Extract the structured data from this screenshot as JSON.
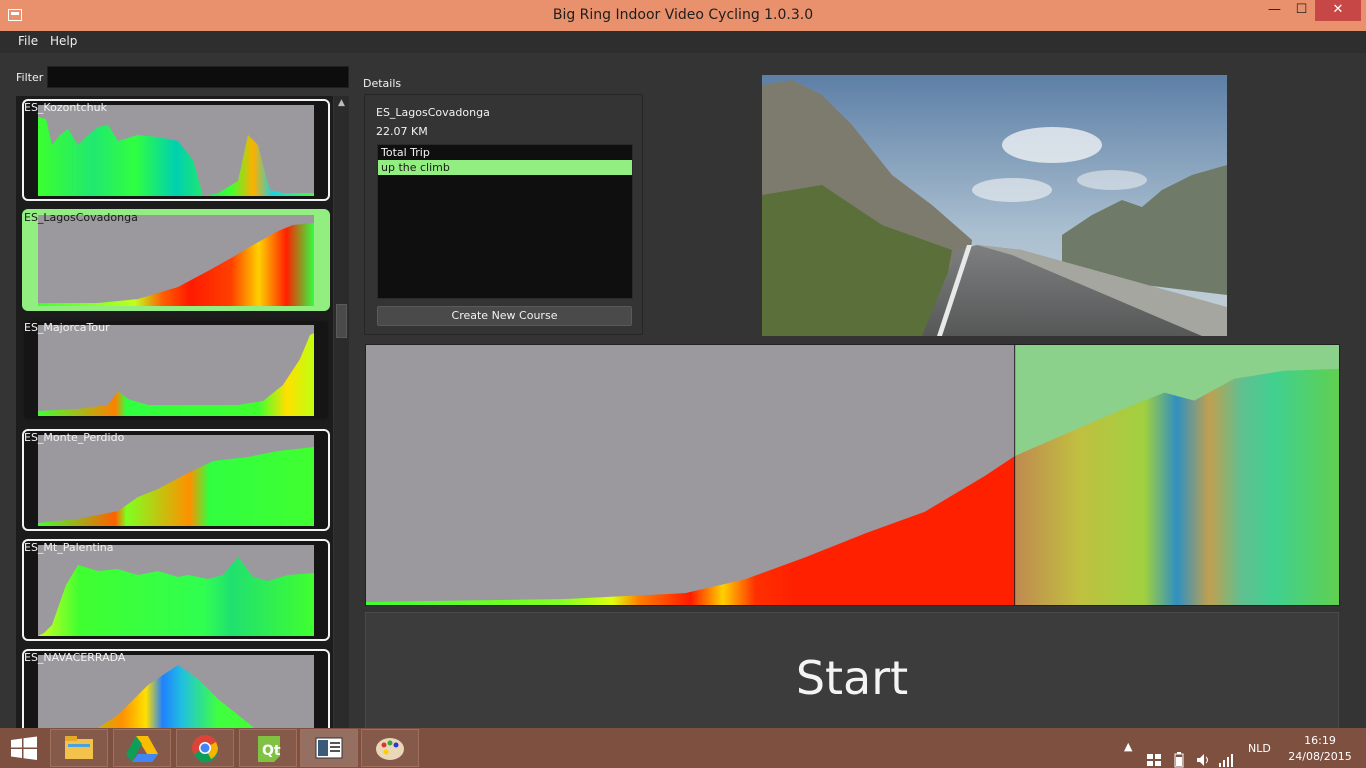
{
  "window": {
    "title": "Big Ring Indoor Video Cycling 1.0.3.0",
    "minimize_glyph": "—",
    "maximize_glyph": "☐",
    "close_glyph": "✕"
  },
  "menu": {
    "items": [
      {
        "label": "File"
      },
      {
        "label": "Help"
      }
    ]
  },
  "filter": {
    "label": "Filter",
    "value": ""
  },
  "courses": [
    {
      "name": "ES_Kozontchuk",
      "selected": false
    },
    {
      "name": "ES_LagosCovadonga",
      "selected": true
    },
    {
      "name": "ES_MajorcaTour",
      "selected": false
    },
    {
      "name": "ES_Monte_Perdido",
      "selected": false
    },
    {
      "name": "ES_Mt_Palentina",
      "selected": false
    },
    {
      "name": "ES_NAVACERRADA",
      "selected": false
    }
  ],
  "details": {
    "label": "Details",
    "course_name": "ES_LagosCovadonga",
    "distance": "22.07 KM",
    "ranges": [
      {
        "label": "Total Trip",
        "selected": false
      },
      {
        "label": "up the climb",
        "selected": true
      }
    ],
    "create_button": "Create New Course"
  },
  "start_button": "Start",
  "taskbar": {
    "apps": [
      {
        "icon": "file-explorer-icon",
        "active": false
      },
      {
        "icon": "google-drive-icon",
        "active": false
      },
      {
        "icon": "chrome-icon",
        "active": false
      },
      {
        "icon": "qt-creator-icon",
        "active": false
      },
      {
        "icon": "big-ring-app-icon",
        "active": true
      },
      {
        "icon": "paint-icon",
        "active": false
      }
    ],
    "language": "NLD",
    "time": "16:19",
    "date": "24/08/2015"
  },
  "colors": {
    "titlebar": "#e9916c",
    "taskbar": "#7e5040",
    "selection": "#92ee80",
    "profile_background": "#9b999d"
  }
}
